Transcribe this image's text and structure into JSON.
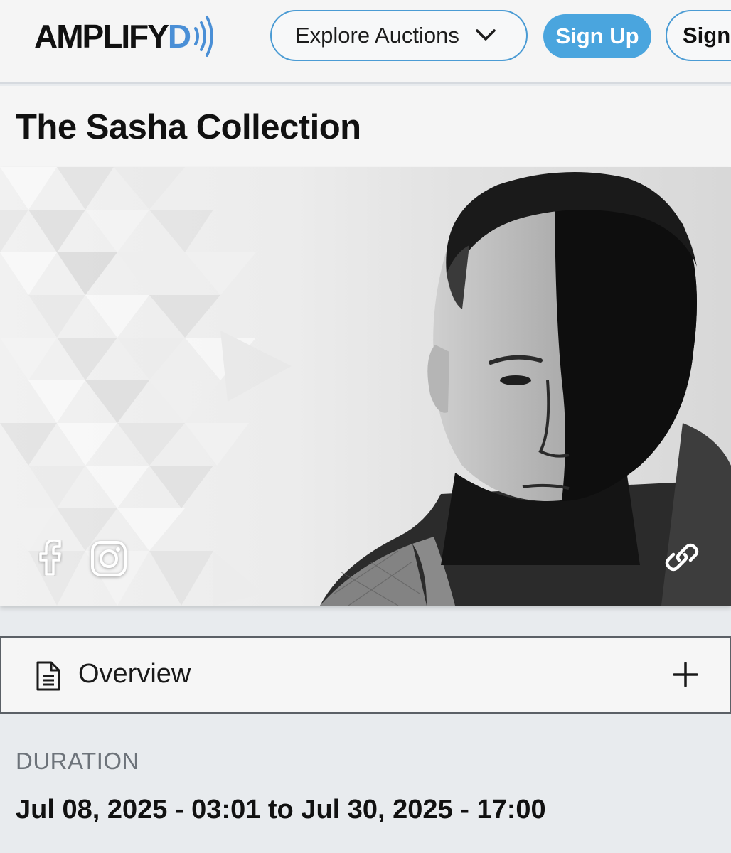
{
  "header": {
    "logo_text": "AMPLIFY",
    "logo_d": "D",
    "explore_label": "Explore Auctions",
    "signup_label": "Sign Up",
    "signin_label": "Sign"
  },
  "page": {
    "title": "The Sasha Collection"
  },
  "banner": {
    "social_links": [
      "facebook-icon",
      "instagram-icon"
    ],
    "share_icon": "link-icon"
  },
  "overview": {
    "label": "Overview",
    "expand_icon": "plus-icon"
  },
  "duration": {
    "label": "DURATION",
    "value": "Jul 08, 2025 - 03:01 to Jul 30, 2025 - 17:00"
  },
  "colors": {
    "accent": "#4aa5de",
    "border_blue": "#4a9bd4",
    "logo_blue": "#4a8fd6"
  }
}
